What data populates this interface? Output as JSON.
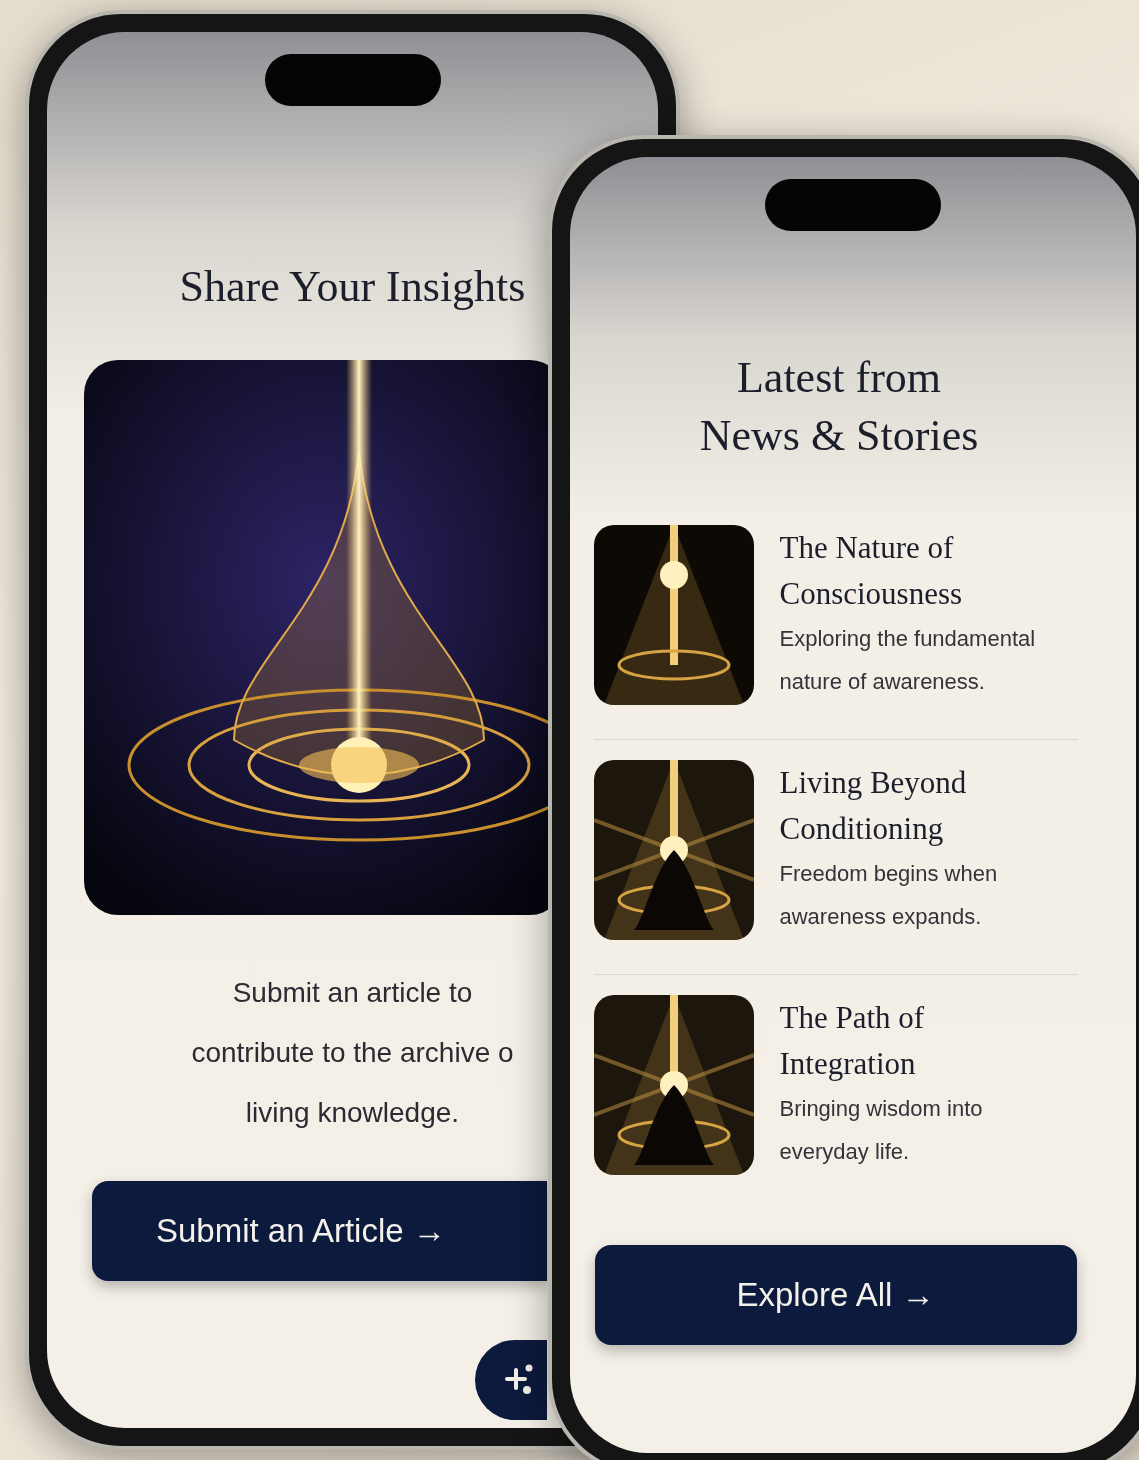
{
  "back_phone": {
    "heading": "Share Your Insights",
    "hero": {
      "kind": "picture"
    },
    "description_lines": [
      "Submit an article to",
      "contribute to the archive o",
      "living knowledge."
    ],
    "button": {
      "label": "Submit an Article →"
    }
  },
  "front_phone": {
    "title_lines": [
      "Latest from",
      "News & Stories"
    ],
    "articles": [
      {
        "title_lines": [
          "The Nature of",
          "Consciousness"
        ],
        "summary_lines": [
          "Exploring the fundamental",
          "nature of awareness."
        ],
        "thumbnail": {
          "kind": "picture"
        }
      },
      {
        "title_lines": [
          "Living Beyond",
          "Conditioning"
        ],
        "summary_lines": [
          "Freedom begins when",
          "awareness expands."
        ],
        "thumbnail": {
          "kind": "picture"
        }
      },
      {
        "title_lines": [
          "The Path of",
          "Integration"
        ],
        "summary_lines": [
          "Bringing wisdom into",
          "everyday life."
        ],
        "thumbnail": {
          "kind": "picture"
        }
      }
    ],
    "button": {
      "label": "Explore All →"
    }
  }
}
